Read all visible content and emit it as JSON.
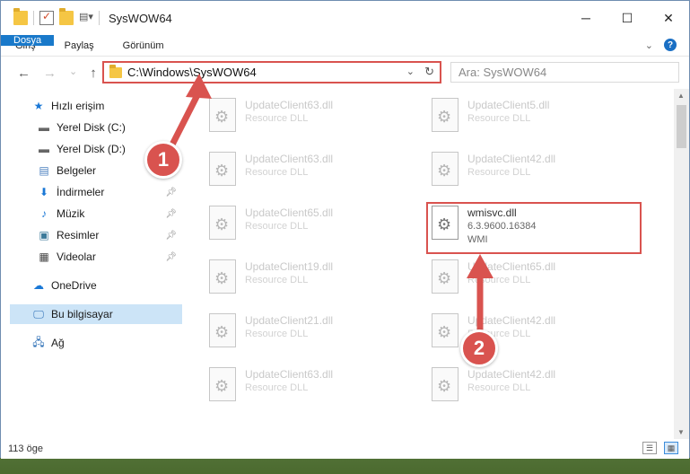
{
  "window": {
    "title": "SysWOW64",
    "controls": {
      "minimize": "─",
      "maximize": "☐",
      "close": "✕"
    }
  },
  "ribbon": {
    "tabs": [
      "Dosya",
      "Giriş",
      "Paylaş",
      "Görünüm"
    ],
    "expand_icon": "chevron-down-icon",
    "help_label": "?"
  },
  "nav": {
    "back": "←",
    "forward": "→",
    "dropdown": "⌄",
    "up": "↑"
  },
  "address": {
    "path": "C:\\Windows\\SysWOW64",
    "dropdown": "⌄",
    "refresh": "↻"
  },
  "search": {
    "placeholder": "Ara: SysWOW64"
  },
  "sidebar": {
    "items": [
      {
        "label": "Hızlı erişim",
        "icon": "star-icon",
        "pinned": false,
        "selected": false
      },
      {
        "label": "Yerel Disk (C:)",
        "icon": "drive-icon",
        "pinned": false,
        "selected": false
      },
      {
        "label": "Yerel Disk (D:)",
        "icon": "drive-icon",
        "pinned": false,
        "selected": false
      },
      {
        "label": "Belgeler",
        "icon": "documents-icon",
        "pinned": false,
        "selected": false
      },
      {
        "label": "İndirmeler",
        "icon": "download-icon",
        "pinned": true,
        "selected": false
      },
      {
        "label": "Müzik",
        "icon": "music-icon",
        "pinned": true,
        "selected": false
      },
      {
        "label": "Resimler",
        "icon": "pictures-icon",
        "pinned": true,
        "selected": false
      },
      {
        "label": "Videolar",
        "icon": "videos-icon",
        "pinned": true,
        "selected": false
      },
      {
        "label": "OneDrive",
        "icon": "cloud-icon",
        "pinned": false,
        "selected": false
      },
      {
        "label": "Bu bilgisayar",
        "icon": "computer-icon",
        "pinned": false,
        "selected": true
      },
      {
        "label": "Ağ",
        "icon": "network-icon",
        "pinned": false,
        "selected": false
      }
    ]
  },
  "files": [
    {
      "name": "UpdateClient63.dll",
      "sub1": "Resource DLL",
      "sub2": ""
    },
    {
      "name": "UpdateClient5.dll",
      "sub1": "Resource DLL",
      "sub2": ""
    },
    {
      "name": "UpdateClient63.dll",
      "sub1": "Resource DLL",
      "sub2": ""
    },
    {
      "name": "UpdateClient42.dll",
      "sub1": "Resource DLL",
      "sub2": ""
    },
    {
      "name": "UpdateClient65.dll",
      "sub1": "Resource DLL",
      "sub2": ""
    },
    {
      "name": "wmisvc.dll",
      "sub1": "6.3.9600.16384",
      "sub2": "WMI",
      "highlight": true
    },
    {
      "name": "UpdateClient19.dll",
      "sub1": "Resource DLL",
      "sub2": ""
    },
    {
      "name": "UpdateClient65.dll",
      "sub1": "Resource DLL",
      "sub2": ""
    },
    {
      "name": "UpdateClient21.dll",
      "sub1": "Resource DLL",
      "sub2": ""
    },
    {
      "name": "UpdateClient42.dll",
      "sub1": "Resource DLL",
      "sub2": ""
    },
    {
      "name": "UpdateClient63.dll",
      "sub1": "Resource DLL",
      "sub2": ""
    },
    {
      "name": "UpdateClient42.dll",
      "sub1": "Resource DLL",
      "sub2": ""
    }
  ],
  "status": {
    "count": "113 öge"
  },
  "annotations": {
    "step1": "1",
    "step2": "2",
    "color": "#d9534f"
  }
}
